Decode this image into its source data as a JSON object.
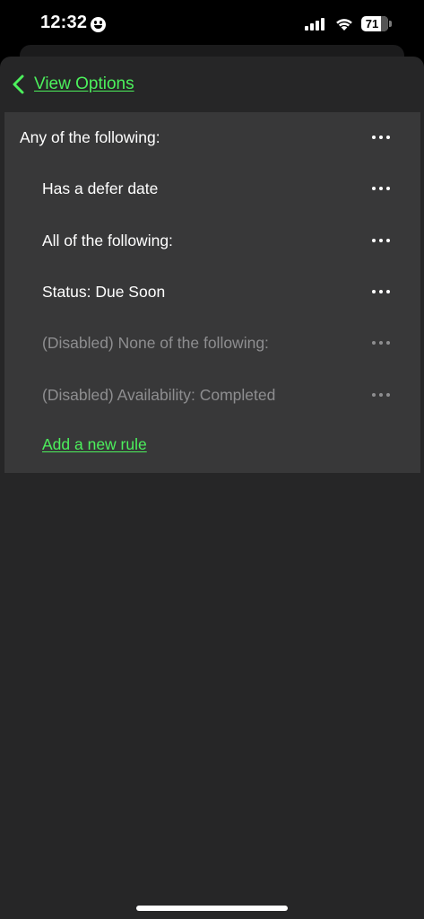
{
  "status_bar": {
    "time": "12:32",
    "focus_icon": "smiley-face-icon",
    "signal_icon": "cellular-signal-icon",
    "wifi_icon": "wifi-icon",
    "battery_level": "71",
    "battery_icon": "battery-icon"
  },
  "nav": {
    "back_label": "View Options",
    "back_icon": "chevron-left-icon",
    "accent_color": "#4cf05c"
  },
  "rules": {
    "items": [
      {
        "label": "Any of the following:",
        "level": 0,
        "disabled": false
      },
      {
        "label": "Has a defer date",
        "level": 1,
        "disabled": false
      },
      {
        "label": "All of the following:",
        "level": 1,
        "disabled": false
      },
      {
        "label": "Status: Due Soon",
        "level": 1,
        "disabled": false
      },
      {
        "label": "(Disabled) None of the following:",
        "level": 1,
        "disabled": true
      },
      {
        "label": "(Disabled) Availability: Completed",
        "level": 1,
        "disabled": true
      }
    ],
    "more_icon": "ellipsis-icon",
    "add_rule_label": "Add a new rule"
  },
  "colors": {
    "background": "#262627",
    "panel": "#383839",
    "text": "#ffffff",
    "disabled_text": "#8e8e90"
  }
}
